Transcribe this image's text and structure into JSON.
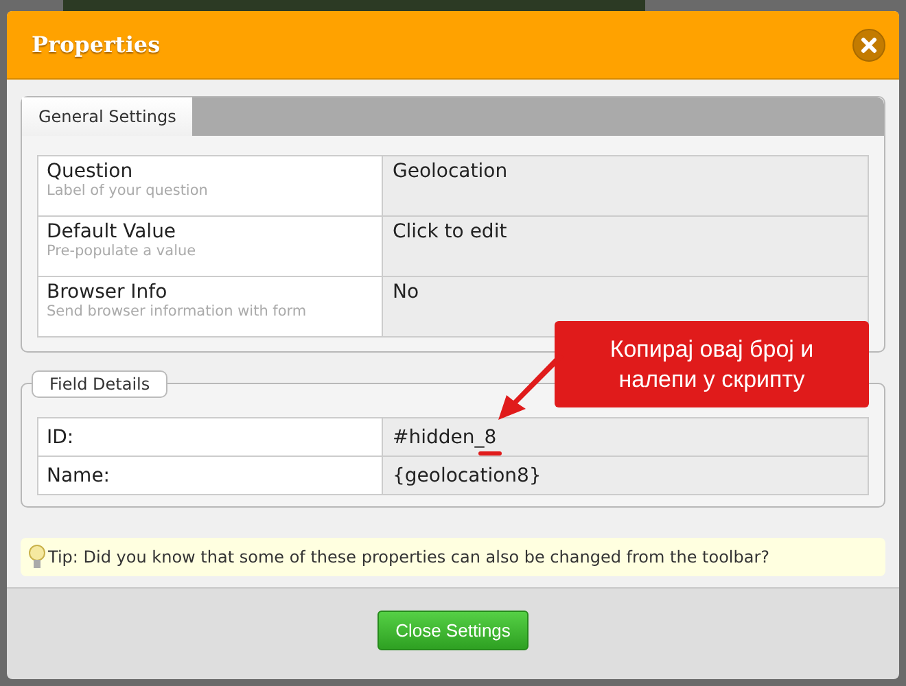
{
  "dialog": {
    "title": "Properties"
  },
  "tabs": [
    {
      "label": "General Settings",
      "selected": true
    }
  ],
  "general_settings": [
    {
      "label": "Question",
      "hint": "Label of your question",
      "value": "Geolocation"
    },
    {
      "label": "Default Value",
      "hint": "Pre-populate a value",
      "value": "Click to edit"
    },
    {
      "label": "Browser Info",
      "hint": "Send browser information with form",
      "value": "No"
    }
  ],
  "field_details": {
    "legend": "Field Details",
    "rows": [
      {
        "label": "ID:",
        "value": "#hidden_8",
        "underlined": true
      },
      {
        "label": "Name:",
        "value": "{geolocation8}",
        "underlined": false
      }
    ]
  },
  "callout": {
    "text": "Копирај овај број и налепи у скрипту"
  },
  "tip": "Tip: Did you know that some of these properties can also be changed from the toolbar?",
  "buttons": [
    {
      "label": "Close Settings"
    }
  ]
}
